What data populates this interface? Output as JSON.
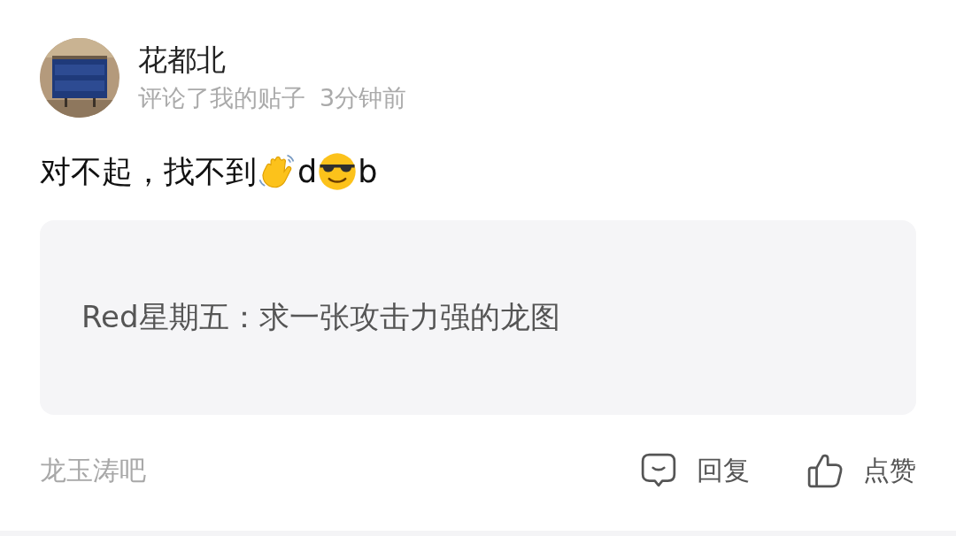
{
  "user": {
    "name": "花都北",
    "action": "评论了我的贴子",
    "time": "3分钟前"
  },
  "comment": [
    {
      "kind": "text",
      "text": "对不起，找不到"
    },
    {
      "kind": "wave"
    },
    {
      "kind": "text",
      "text": "d"
    },
    {
      "kind": "cool"
    },
    {
      "kind": "text",
      "text": "b"
    }
  ],
  "quote": "Red星期五：求一张攻击力强的龙图",
  "footer": {
    "forum": "龙玉涛吧",
    "reply": "回复",
    "like": "点赞"
  }
}
